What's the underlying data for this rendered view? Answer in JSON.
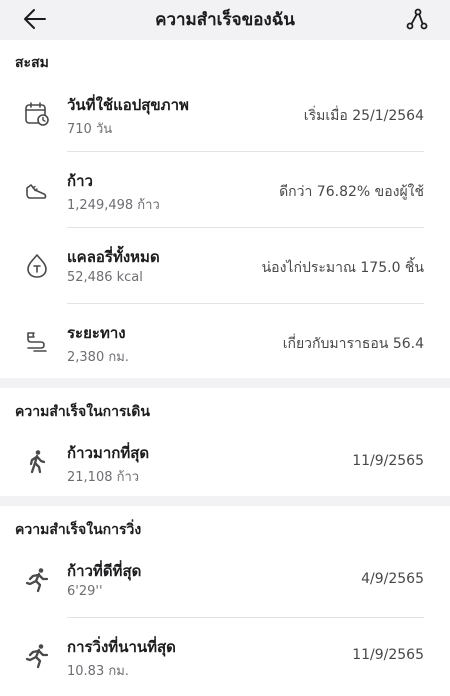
{
  "header": {
    "title": "ความสำเร็จของฉัน"
  },
  "cumulative": {
    "title": "สะสม",
    "items": [
      {
        "icon": "calendar-icon",
        "label": "วันที่ใช้แอปสุขภาพ",
        "value": "710 วัน",
        "note": "เริ่มเมื่อ 25/1/2564"
      },
      {
        "icon": "sneaker-icon",
        "label": "ก้าว",
        "value": "1,249,498 ก้าว",
        "note": "ดีกว่า 76.82% ของผู้ใช้"
      },
      {
        "icon": "calorie-icon",
        "label": "แคลอรี่ทั้งหมด",
        "value": "52,486 kcal",
        "note": "น่องไก่ประมาณ 175.0 ชิ้น"
      },
      {
        "icon": "distance-icon",
        "label": "ระยะทาง",
        "value": "2,380 กม.",
        "note": "เกี่ยวกับมาราธอน 56.4"
      }
    ]
  },
  "walking": {
    "title": "ความสำเร็จในการเดิน",
    "items": [
      {
        "icon": "walking-person-icon",
        "label": "ก้าวมากที่สุด",
        "value": "21,108 ก้าว",
        "note": "11/9/2565"
      }
    ]
  },
  "running": {
    "title": "ความสำเร็จในการวิ่ง",
    "items": [
      {
        "icon": "running-person-icon",
        "label": "ก้าวที่ดีที่สุด",
        "value": "6'29''",
        "note": "4/9/2565"
      },
      {
        "icon": "running-person-icon",
        "label": "การวิ่งที่นานที่สุด",
        "value": "10.83 กม.",
        "note": "11/9/2565"
      }
    ]
  }
}
